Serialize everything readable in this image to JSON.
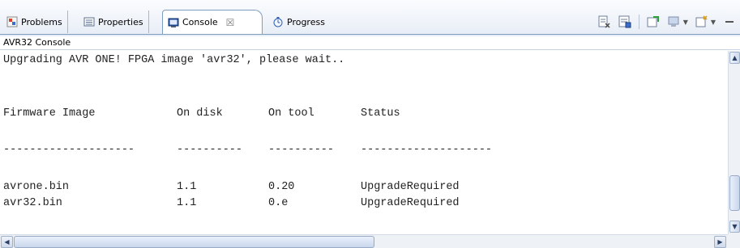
{
  "tabs": [
    {
      "label": "Problems",
      "icon": "problems-icon"
    },
    {
      "label": "Properties",
      "icon": "properties-icon"
    },
    {
      "label": "Console",
      "icon": "console-icon",
      "close": "☒"
    },
    {
      "label": "Progress",
      "icon": "progress-icon"
    }
  ],
  "view": {
    "console_name": "AVR32 Console"
  },
  "console": {
    "message": "Upgrading AVR ONE! FPGA image 'avr32', please wait..",
    "headers": [
      "Firmware Image",
      "On disk",
      "On tool",
      "Status"
    ],
    "separators": [
      "--------------------",
      "----------",
      "----------",
      "--------------------"
    ],
    "rows": [
      [
        "avrone.bin",
        "1.1",
        "0.20",
        "UpgradeRequired"
      ],
      [
        "avr32.bin",
        "1.1",
        "0.e",
        "UpgradeRequired"
      ]
    ]
  },
  "colors": {
    "tab_border": "#7f9dbf",
    "text": "#222222"
  }
}
